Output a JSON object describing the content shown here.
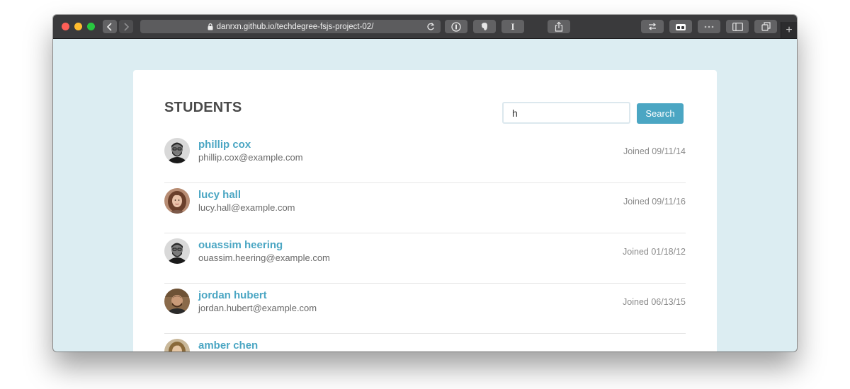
{
  "browser": {
    "url": "danrxn.github.io/techdegree-fsjs-project-02/"
  },
  "page": {
    "title": "STUDENTS",
    "search": {
      "value": "h",
      "button_label": "Search"
    }
  },
  "students": [
    {
      "name": "phillip cox",
      "email": "phillip.cox@example.com",
      "joined": "Joined 09/11/14"
    },
    {
      "name": "lucy hall",
      "email": "lucy.hall@example.com",
      "joined": "Joined 09/11/16"
    },
    {
      "name": "ouassim heering",
      "email": "ouassim.heering@example.com",
      "joined": "Joined 01/18/12"
    },
    {
      "name": "jordan hubert",
      "email": "jordan.hubert@example.com",
      "joined": "Joined 06/13/15"
    },
    {
      "name": "amber chen",
      "email": "",
      "joined": ""
    }
  ],
  "colors": {
    "accent": "#4ba6c3",
    "page_background": "#dcedf2",
    "toolbar": "#3a3a3c"
  }
}
